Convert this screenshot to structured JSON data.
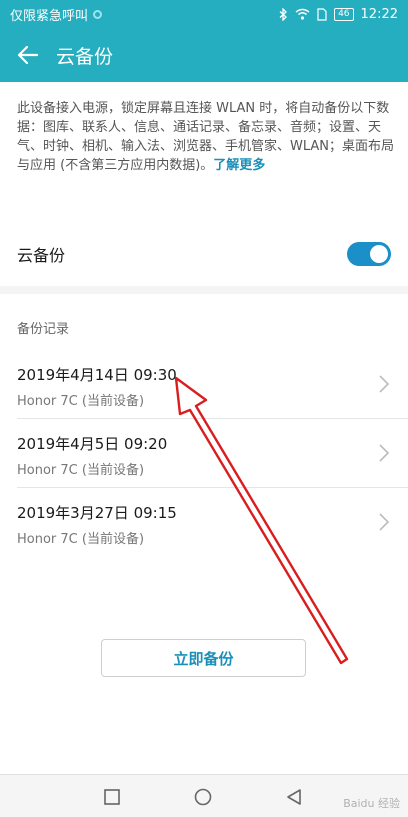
{
  "status_bar": {
    "carrier_text": "仅限紧急呼叫",
    "battery": "46",
    "time": "12:22"
  },
  "app_bar": {
    "title": "云备份"
  },
  "intro": {
    "description": "此设备接入电源，锁定屏幕且连接 WLAN 时，将自动备份以下数据：图库、联系人、信息、通话记录、备忘录、音频；设置、天气、时钟、相机、输入法、浏览器、手机管家、WLAN；桌面布局与应用 (不含第三方应用内数据)。",
    "learn_more": "了解更多"
  },
  "toggle": {
    "label": "云备份",
    "state": "on"
  },
  "records": {
    "section_title": "备份记录",
    "items": [
      {
        "date": "2019年4月14日 09:30",
        "device": "Honor 7C (当前设备)"
      },
      {
        "date": "2019年4月5日 09:20",
        "device": "Honor 7C (当前设备)"
      },
      {
        "date": "2019年3月27日 09:15",
        "device": "Honor 7C (当前设备)"
      }
    ]
  },
  "actions": {
    "backup_now": "立即备份"
  },
  "icons": {
    "back": "arrow-left-icon",
    "chevron": "chevron-right-icon",
    "nav": [
      "square-icon",
      "circle-icon",
      "triangle-back-icon"
    ]
  },
  "colors": {
    "accent": "#24aec0",
    "switch": "#1a8fc8",
    "link": "#1a8fb8",
    "annotation_arrow": "#d81e1e"
  },
  "watermark": "Baidu 经验"
}
